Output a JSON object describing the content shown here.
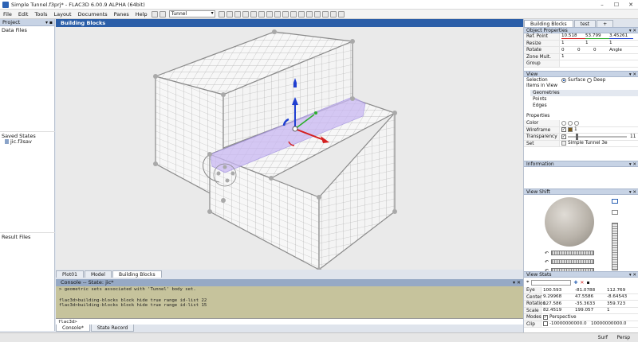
{
  "window": {
    "title": "Simple Tunnel.f3prj* - FLAC3D 6.00.9 ALPHA (64bit)"
  },
  "menu": {
    "items": [
      "File",
      "Edit",
      "Tools",
      "Layout",
      "Documents",
      "Panes",
      "Help"
    ],
    "model_select": "Tunnel"
  },
  "left": {
    "project_title": "Project",
    "data_files": "Data Files",
    "saved_states": "Saved States",
    "saved_state_file": "jic.f3sav",
    "result_files": "Result Files"
  },
  "view": {
    "title": "Building Blocks",
    "tabs": [
      "Plot01",
      "Model",
      "Building Blocks"
    ],
    "active_tab": "Building Blocks"
  },
  "console": {
    "title": "Console -- State: jic*",
    "lines": [
      "> geometric sets associated with 'Tunnel' body set.",
      "",
      "flac3d>building-blocks block hide true range id-list 22",
      "flac3d>building-blocks block hide true range id-list 15",
      "",
      ""
    ],
    "prompt": "flac3d>",
    "tabs": [
      "Console*",
      "State Record"
    ]
  },
  "right": {
    "tabs": [
      "Building Blocks",
      "test",
      "+"
    ],
    "object_properties": {
      "title": "Object Properties",
      "ref_point_label": "Ref. Point",
      "ref_point": [
        "10.518",
        "53.799",
        "3.45261"
      ],
      "resize_label": "Resize",
      "resize": [
        "1",
        "1",
        "1"
      ],
      "rotate_label": "Rotate",
      "rotate": [
        "0",
        "0",
        "0"
      ],
      "rotate_angle": "Angle",
      "zone_mult_label": "Zone Mult.",
      "zone_mult": "1",
      "group_label": "Group"
    },
    "view": {
      "title": "View",
      "selection_label": "Selection",
      "surface": "Surface",
      "deep": "Deep",
      "items_label": "Items in View",
      "items": [
        "Geometries",
        "Points",
        "Edges"
      ]
    },
    "properties": {
      "title": "Properties",
      "color_label": "Color",
      "wireframe_label": "Wireframe",
      "wireframe_value": "1",
      "transparency_label": "Transparency",
      "transparency_value": "11",
      "set_label": "Set",
      "set_value": "Simple Tunnel 3e"
    },
    "information": {
      "title": "Information"
    },
    "view_shift": {
      "title": "View Shift"
    },
    "view_stats": {
      "title": "View Stats",
      "rows": [
        {
          "label": "Eye",
          "values": [
            "100.593",
            "-81.0788",
            "112.769"
          ]
        },
        {
          "label": "Center",
          "values": [
            "9.29968",
            "47.5586",
            "-8.64543"
          ]
        },
        {
          "label": "Rotation",
          "values": [
            "127.586",
            "-35.3633",
            "359.723"
          ]
        },
        {
          "label": "Scale",
          "values": [
            "82.4519",
            "199.057",
            "1"
          ]
        }
      ],
      "modes_label": "Modes",
      "perspective": "Perspective",
      "clip_label": "Clip",
      "clip": [
        "-10000000000.0",
        "10000000000.0"
      ]
    }
  },
  "status": {
    "surf": "Surf",
    "persp": "Persp"
  },
  "colors": {
    "viewhead": "#2b5ea8",
    "console_bg": "#c6c39c",
    "panel_head": "#c7d3e5",
    "tunnel": "#c9b8f2"
  }
}
